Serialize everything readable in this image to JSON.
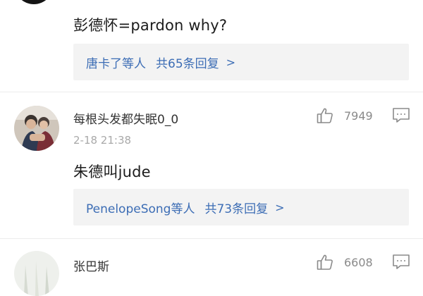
{
  "comment1": {
    "text": "彭德怀=pardon why?",
    "reply_summary": {
      "users_label": "唐卡了等人",
      "count_label": "共65条回复",
      "chevron": ">"
    }
  },
  "comment2": {
    "username": "每根头发都失眠0_0",
    "timestamp": "2-18 21:38",
    "likes": "7949",
    "text": "朱德叫jude",
    "reply_summary": {
      "users_label": "PenelopeSong等人",
      "count_label": "共73条回复",
      "chevron": ">"
    }
  },
  "comment3": {
    "username": "张巴斯",
    "likes": "6608"
  },
  "icons": {
    "like": "thumbs-up-icon",
    "reply": "comment-icon",
    "chevron": "chevron-right-icon"
  },
  "colors": {
    "link": "#3c6db5",
    "timestamp": "#a9a9a9",
    "reply_bg": "#f3f3f3"
  }
}
